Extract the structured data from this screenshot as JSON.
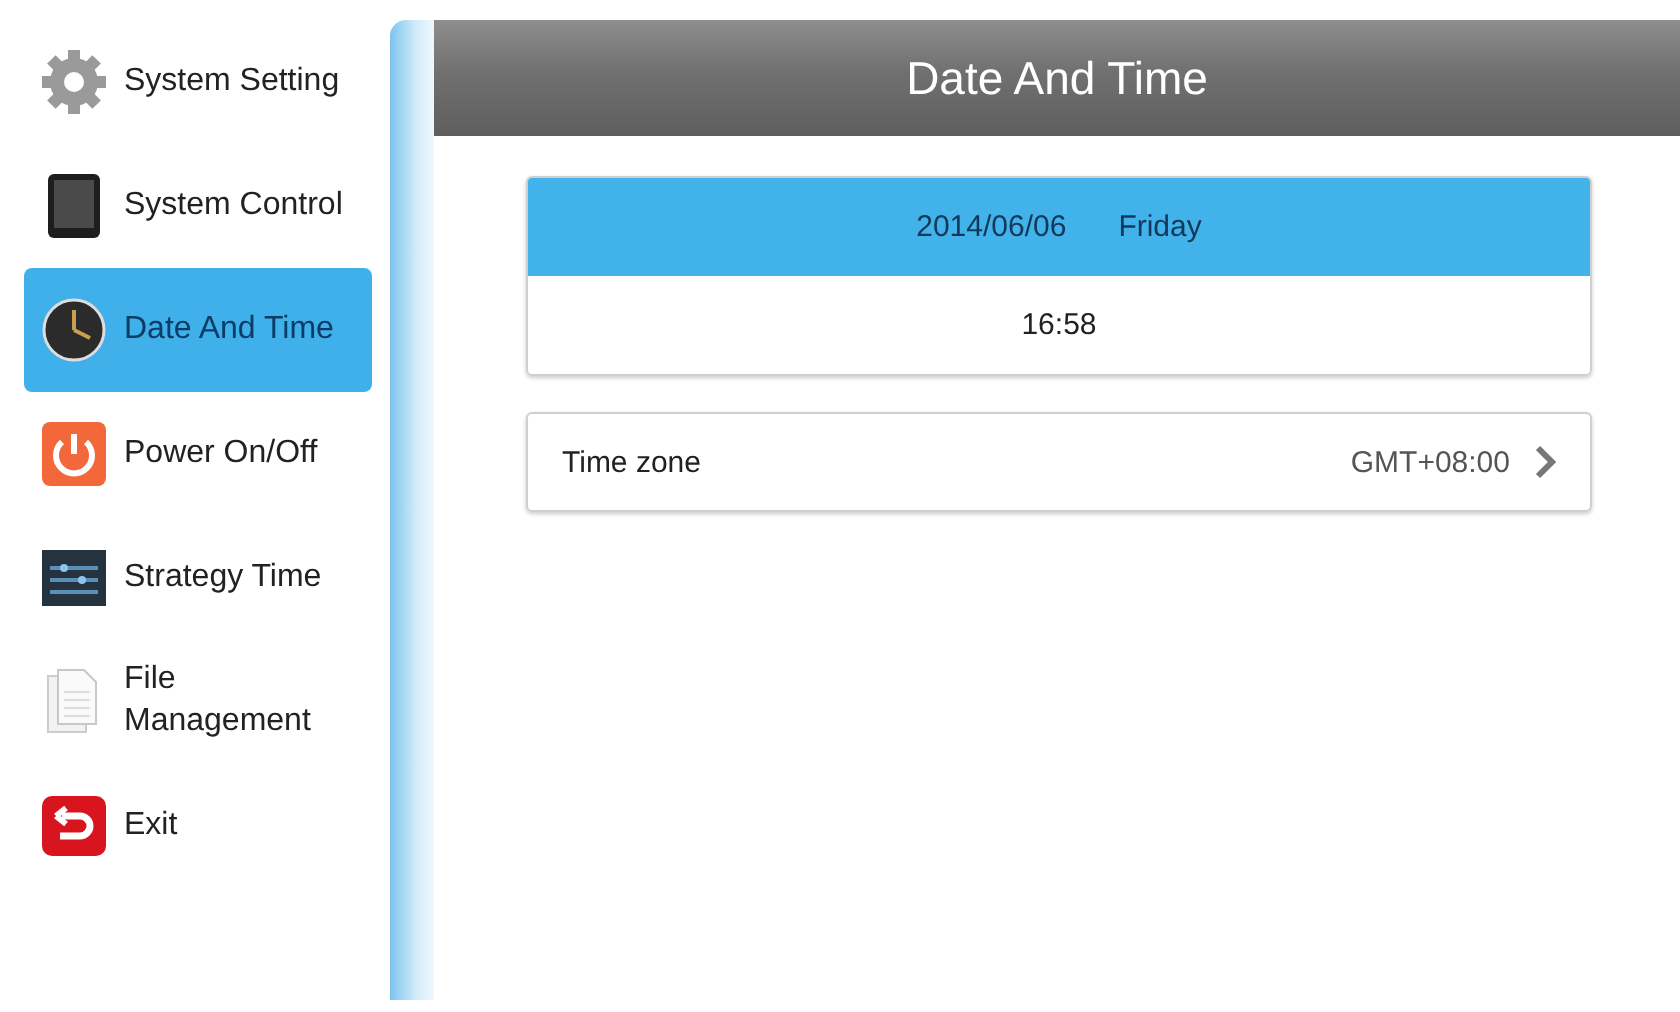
{
  "sidebar": {
    "items": [
      {
        "label": "System Setting",
        "kind": "gear",
        "selected": false
      },
      {
        "label": "System Control",
        "kind": "tablet",
        "selected": false
      },
      {
        "label": "Date And Time",
        "kind": "clock",
        "selected": true
      },
      {
        "label": "Power On/Off",
        "kind": "power",
        "selected": false
      },
      {
        "label": "Strategy Time",
        "kind": "strategy",
        "selected": false
      },
      {
        "label": "File Management",
        "kind": "file",
        "selected": false
      },
      {
        "label": "Exit",
        "kind": "exit",
        "selected": false
      }
    ]
  },
  "header": {
    "title": "Date And Time"
  },
  "date_card": {
    "date": "2014/06/06",
    "weekday": "Friday",
    "time": "16:58"
  },
  "time_zone": {
    "label": "Time zone",
    "value": "GMT+08:00"
  }
}
